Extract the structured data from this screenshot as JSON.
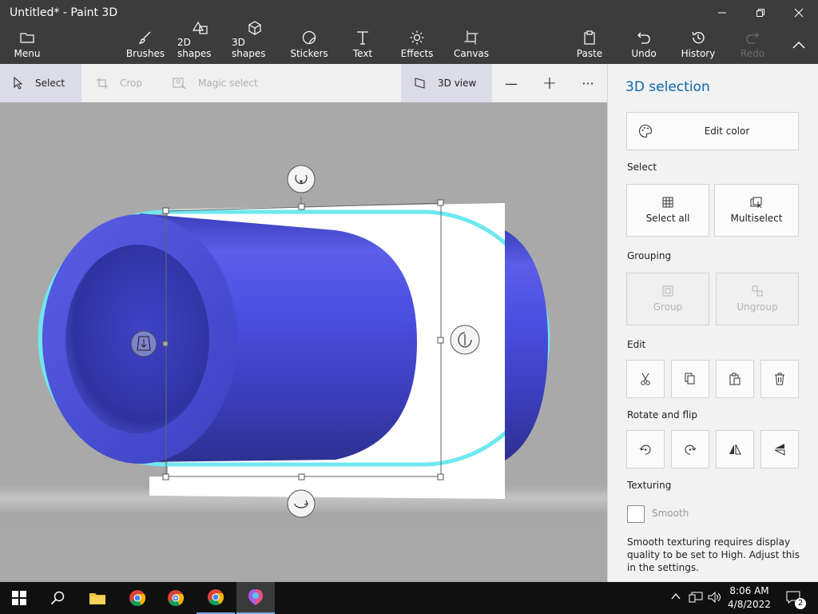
{
  "window": {
    "title": "Untitled* - Paint 3D"
  },
  "ribbon": {
    "menu": "Menu",
    "brushes": "Brushes",
    "shapes2d": "2D shapes",
    "shapes3d": "3D shapes",
    "stickers": "Stickers",
    "text": "Text",
    "effects": "Effects",
    "canvas": "Canvas",
    "paste": "Paste",
    "undo": "Undo",
    "history": "History",
    "redo": "Redo"
  },
  "toolbar": {
    "select": "Select",
    "crop": "Crop",
    "magic_select": "Magic select",
    "view3d": "3D view",
    "zoom_out": "—",
    "zoom_in": "+",
    "more": "···"
  },
  "panel": {
    "title": "3D selection",
    "edit_color": "Edit color",
    "select_heading": "Select",
    "select_all": "Select all",
    "multiselect": "Multiselect",
    "grouping_heading": "Grouping",
    "group": "Group",
    "ungroup": "Ungroup",
    "edit_heading": "Edit",
    "rotate_heading": "Rotate and flip",
    "texturing_heading": "Texturing",
    "smooth": "Smooth",
    "smooth_note": "Smooth texturing requires display quality to be set to High. Adjust this in the settings."
  },
  "taskbar": {
    "time": "8:06 AM",
    "date": "4/8/2022",
    "notifications": "2"
  },
  "colors": {
    "chrome": "#3c3c3c",
    "accent": "#0a64ad",
    "selection_glow": "#6ee8f0",
    "cylinder": "#4a4ed6"
  }
}
